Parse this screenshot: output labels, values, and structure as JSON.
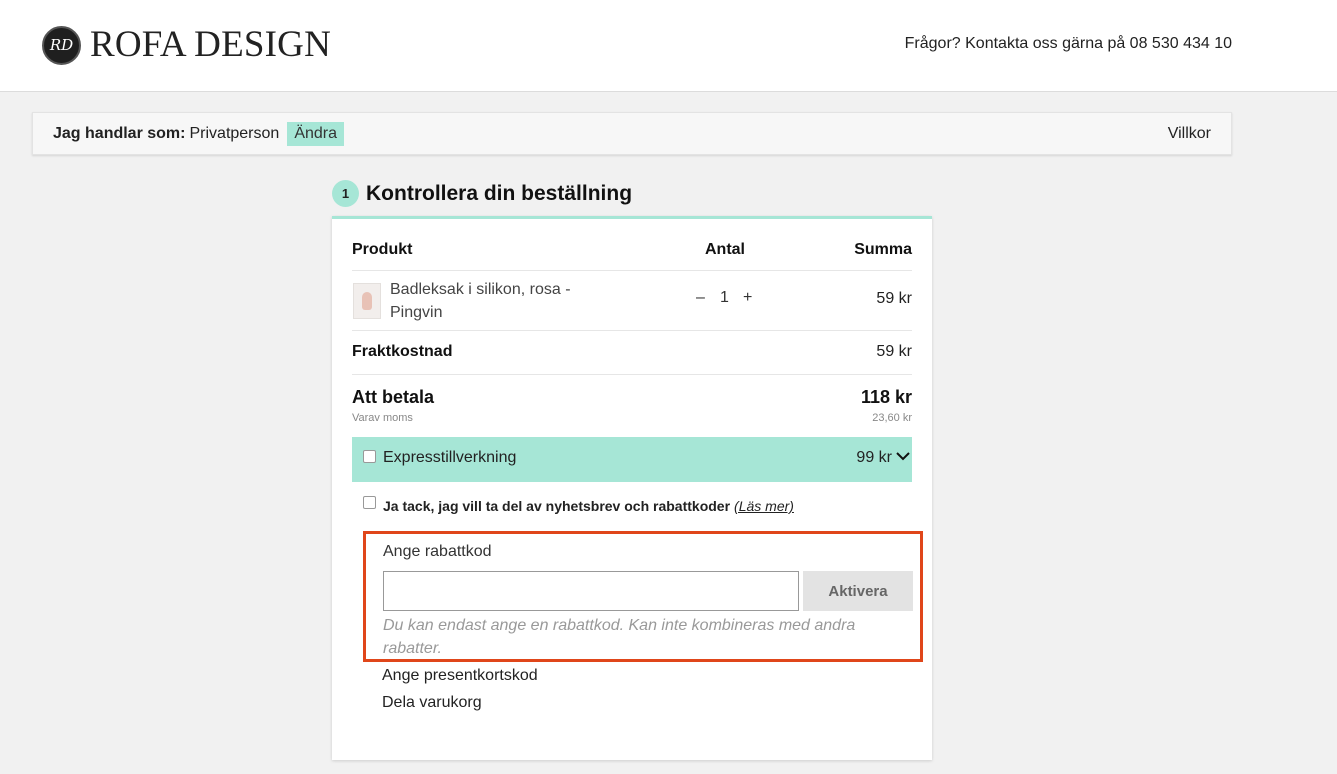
{
  "header": {
    "logo_text": "ROFA DESIGN",
    "logo_mark": "RD",
    "contact_text": "Frågor? Kontakta oss gärna på 08 530 434 10"
  },
  "buyer_bar": {
    "label": "Jag handlar som:",
    "value": "Privatperson",
    "change_label": "Ändra",
    "terms_label": "Villkor"
  },
  "step": {
    "number": "1",
    "title": "Kontrollera din beställning"
  },
  "cart": {
    "columns": {
      "product": "Produkt",
      "quantity": "Antal",
      "sum": "Summa"
    },
    "items": [
      {
        "name": "Badleksak i silikon, rosa - Pingvin",
        "qty_minus": "–",
        "quantity": "1",
        "qty_plus": "+",
        "price": "59 kr"
      }
    ],
    "shipping": {
      "label": "Fraktkostnad",
      "value": "59 kr"
    },
    "total": {
      "label": "Att betala",
      "value": "118 kr",
      "vat_label": "Varav moms",
      "vat_value": "23,60 kr"
    },
    "express": {
      "label": "Expresstillverkning",
      "price": "99 kr",
      "checked": false
    },
    "newsletter": {
      "label": "Ja tack, jag vill ta del av nyhetsbrev och rabattkoder",
      "read_more": "(Läs mer)",
      "checked": false
    }
  },
  "discount": {
    "label": "Ange rabattkod",
    "input_value": "",
    "button_label": "Aktivera",
    "note": "Du kan endast ange en rabattkod. Kan inte kombineras med andra rabatter."
  },
  "links": {
    "gift_card": "Ange presentkortskod",
    "share_cart": "Dela varukorg"
  },
  "colors": {
    "accent": "#a6e6d6",
    "highlight_border": "#e0461a",
    "background": "#f1f1f1"
  }
}
